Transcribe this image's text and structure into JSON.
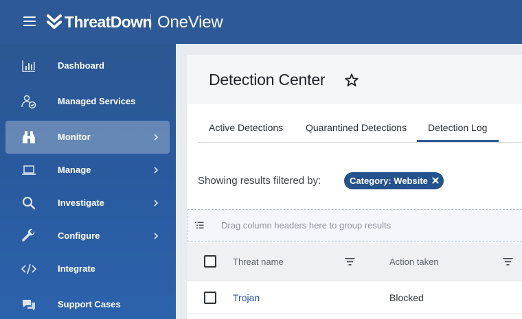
{
  "app": {
    "brand": "ThreatDown",
    "product": "OneView"
  },
  "sidebar": {
    "items": [
      {
        "label": "Dashboard",
        "icon": "bar-chart-icon"
      },
      {
        "label": "Managed Services",
        "icon": "managed-services-icon"
      },
      {
        "label": "Monitor",
        "icon": "binoculars-icon",
        "active": true
      },
      {
        "label": "Manage",
        "icon": "laptop-icon"
      },
      {
        "label": "Investigate",
        "icon": "search-icon"
      },
      {
        "label": "Configure",
        "icon": "wrench-icon"
      },
      {
        "label": "Integrate",
        "icon": "code-icon"
      },
      {
        "label": "Support Cases",
        "icon": "chat-bubbles-icon"
      }
    ]
  },
  "page": {
    "title": "Detection Center"
  },
  "tabs": [
    {
      "label": "Active Detections"
    },
    {
      "label": "Quarantined Detections"
    },
    {
      "label": "Detection Log",
      "active": true
    }
  ],
  "filter": {
    "label": "Showing results filtered by:",
    "chip": "Category: Website"
  },
  "grouping": {
    "placeholder": "Drag column headers here to group results"
  },
  "table": {
    "columns": [
      "Threat name",
      "Action taken"
    ],
    "rows": [
      {
        "threat_name": "Trojan",
        "action_taken": "Blocked"
      }
    ]
  },
  "colors": {
    "header": "#2d5a97",
    "sidebar": "#2a5ba0",
    "accent": "#24528f",
    "link": "#2857a8"
  }
}
